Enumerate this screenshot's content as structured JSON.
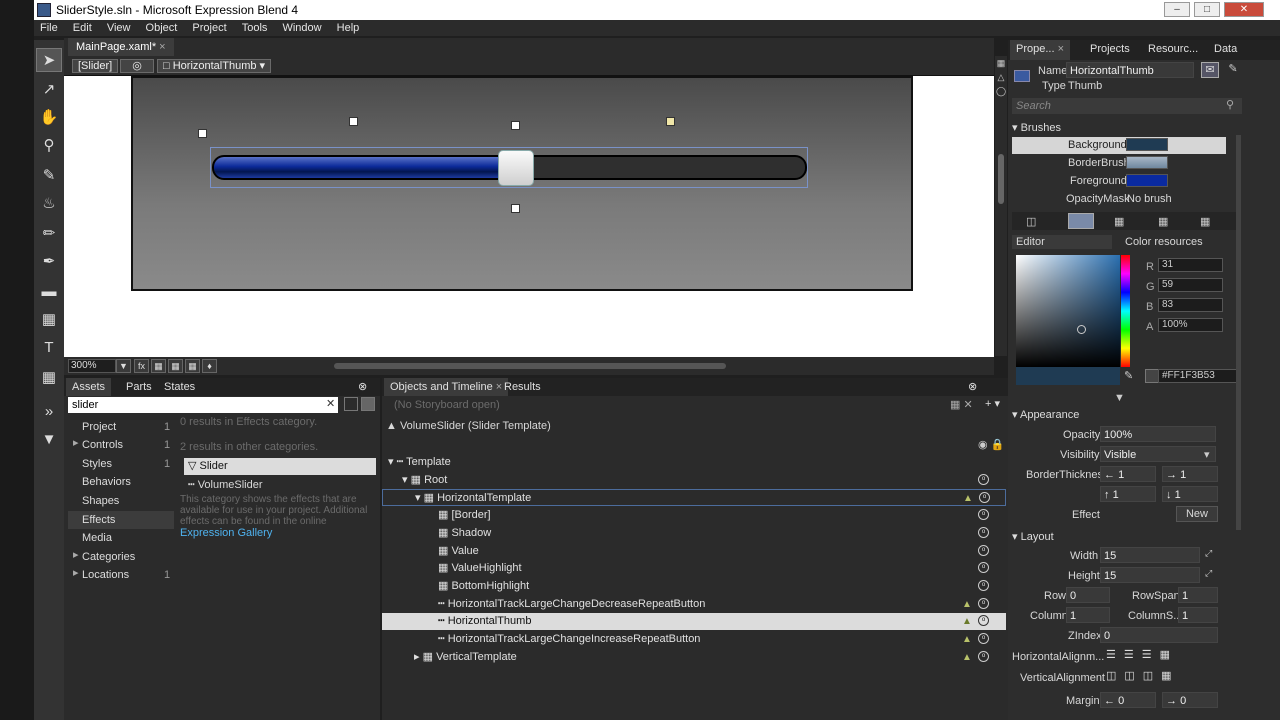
{
  "window": {
    "title": "SliderStyle.sln - Microsoft Expression Blend 4"
  },
  "menu": [
    "File",
    "Edit",
    "View",
    "Object",
    "Project",
    "Tools",
    "Window",
    "Help"
  ],
  "document": {
    "tab": "MainPage.xaml*",
    "breadcrumb": [
      "[Slider]",
      "HorizontalThumb"
    ],
    "zoom": "300%",
    "slider_value_fraction": 0.48
  },
  "assets": {
    "tabs": [
      "Assets",
      "Parts",
      "States"
    ],
    "search": "slider",
    "categories": [
      {
        "label": "Project",
        "count": "1"
      },
      {
        "label": "Controls",
        "count": "1"
      },
      {
        "label": "Styles",
        "count": "1"
      },
      {
        "label": "Behaviors",
        "count": ""
      },
      {
        "label": "Shapes",
        "count": ""
      },
      {
        "label": "Effects",
        "count": ""
      },
      {
        "label": "Media",
        "count": ""
      },
      {
        "label": "Categories",
        "count": ""
      },
      {
        "label": "Locations",
        "count": "1"
      }
    ],
    "results_effects": "0 results in Effects category.",
    "results_other": "2 results in other categories.",
    "result_items": [
      "Slider",
      "VolumeSlider"
    ],
    "note": "This category shows the effects that are available for use in your project. Additional effects can be found in the online",
    "gallery_link": "Expression Gallery"
  },
  "objects": {
    "tabs": [
      "Objects and Timeline",
      "Results"
    ],
    "storyboard": "(No Storyboard open)",
    "template_title": "VolumeSlider (Slider Template)",
    "tree": [
      "Template",
      "Root",
      "HorizontalTemplate",
      "[Border]",
      "Shadow",
      "Value",
      "ValueHighlight",
      "BottomHighlight",
      "HorizontalTrackLargeChangeDecreaseRepeatButton",
      "HorizontalThumb",
      "HorizontalTrackLargeChangeIncreaseRepeatButton",
      "VerticalTemplate"
    ]
  },
  "properties": {
    "tabs": [
      "Prope...",
      "Projects",
      "Resourc...",
      "Data"
    ],
    "name_label": "Name",
    "name_value": "HorizontalThumb",
    "type_label": "Type",
    "type_value": "Thumb",
    "search_placeholder": "Search",
    "brushes_header": "Brushes",
    "brushes": [
      {
        "label": "Background",
        "value": "",
        "color": "#1F3B53"
      },
      {
        "label": "BorderBrush",
        "value": "",
        "color": "#7f98b5"
      },
      {
        "label": "Foreground",
        "value": "",
        "color": "#0a2aa0"
      },
      {
        "label": "OpacityMask",
        "value": "No brush",
        "color": ""
      }
    ],
    "editor_label": "Editor",
    "color_resources": "Color resources",
    "rgba": {
      "R": "31",
      "G": "59",
      "B": "83",
      "A": "100%"
    },
    "hex": "#FF1F3B53",
    "appearance_header": "Appearance",
    "opacity_label": "Opacity",
    "opacity_value": "100%",
    "visibility_label": "Visibility",
    "visibility_value": "Visible",
    "borderthickness_label": "BorderThickness",
    "bt_values": [
      "1",
      "1",
      "1",
      "1"
    ],
    "effect_label": "Effect",
    "effect_button": "New",
    "layout_header": "Layout",
    "width_label": "Width",
    "width_value": "15",
    "height_label": "Height",
    "height_value": "15",
    "row_label": "Row",
    "row_value": "0",
    "rowspan_label": "RowSpan",
    "rowspan_value": "1",
    "column_label": "Column",
    "column_value": "1",
    "columnspan_label": "ColumnS...",
    "columnspan_value": "1",
    "zindex_label": "ZIndex",
    "zindex_value": "0",
    "halign_label": "HorizontalAlignm...",
    "valign_label": "VerticalAlignment",
    "margin_label": "Margin",
    "margin_values": [
      "0",
      "0"
    ]
  }
}
